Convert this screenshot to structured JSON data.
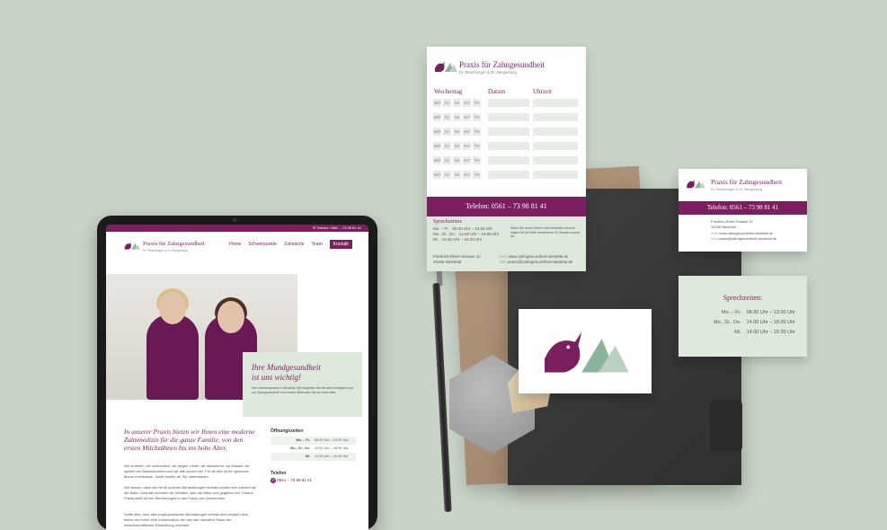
{
  "colors": {
    "brand": "#7b1f5f",
    "accent": "#8bb39a",
    "paper": "#ffffff",
    "mint": "#dfe8dd"
  },
  "brand": {
    "name": "Praxis für Zahngesundheit",
    "subtitle": "Dr. Brachvogel & Dr. Bergerlang",
    "logo_icon": "bird-mountains-logo-icon"
  },
  "appointment_card": {
    "headers": [
      "Wochentag",
      "Datum",
      "Uhrzeit"
    ],
    "days": [
      "MO",
      "DI",
      "MI",
      "DO",
      "FR"
    ],
    "row_count": 6,
    "phone": "Telefon: 0561 – 73 98 81 41",
    "hours_title": "Sprechzeiten:",
    "hours": [
      {
        "days": "Mo. – Fr.",
        "time": "08.00 Uhr – 13.00 Uhr"
      },
      {
        "days": "Mo., Di., Do.",
        "time": "14.00 Uhr – 18.00 Uhr"
      },
      {
        "days": "Mi.",
        "time": "14.00 Uhr – 19.30 Uhr"
      }
    ],
    "note": "Wenn Sie einen Termin nicht einhalten können, sagen Sie ihn bitte mindestens 24 Stunden vorher ab.",
    "address_line1": "Friedrich-Ebert-Strasse 12",
    "address_line2": "34266 Niestetal",
    "web_label": "Web",
    "web": "www.zahngesundheit-niestetal.de",
    "mail_label": "Mail",
    "mail": "praxis@zahngesundheit-niestetal.de"
  },
  "business_card": {
    "phone": "Telefon: 0561 – 73 98 81 41",
    "address_line1": "Friedrich-Ebert-Strasse 12",
    "address_line2": "34266 Niestetal",
    "web_label": "Web",
    "web": "www.zahngesundheit-niestetal.de",
    "mail_label": "Mail",
    "mail": "praxis@zahngesundheit-niestetal.de",
    "hours_title": "Sprechzeiten:",
    "hours": [
      {
        "days": "Mo. – Fr.",
        "time": "08.00 Uhr – 13.00 Uhr"
      },
      {
        "days": "Mo., Di., Do.",
        "time": "14.00 Uhr – 18.00 Uhr"
      },
      {
        "days": "Mi.",
        "time": "14.00 Uhr – 19.30 Uhr"
      }
    ]
  },
  "website": {
    "topbar_phone": "Telefon: 0561 – 73 98 81 41",
    "nav": [
      "Home",
      "Schwerpunkte",
      "Zahnärzte",
      "Team",
      "Kontakt"
    ],
    "hero_title_1": "Ihre Mundgesundheit",
    "hero_title_2": "ist uns wichtig!",
    "hero_text": "Ihre Zahnarztpraxis in Niestetal. Wir begleiten Sie bei allen Anliegen rund um Zahngesundheit vom ersten Milchzahn bis ins hohe Alter.",
    "intro_heading": "In unserer Praxis bieten wir Ihnen eine moderne Zahnmedizin für die ganze Familie, von den ersten Milchzähnen bis ins hohe Alter.",
    "para1": "Wir erzählen, wir schmecken, wir singen Lieder, wir diskutieren, wir küssen: wir spielen ein Blasinstrument und wir alle lachen viel. Für all dies ist ein gesunder Mund unerlässlich. Dabei wollen wir Sie unterstützen.",
    "para2": "Wir wissen, dass wir mit all unseren Behandlungen niemals besser sein werden als die Natur. Deshalb möchten wir erhalten, was die Natur uns gegeben hat. Unsere Praxis stellt all ihre Bemühungen in den Fokus des Zahnerhalts.",
    "para3": "Sollte dies, trotz aller prophylaktischer Bemühungen einmal nicht möglich sein, bieten wir Ihnen eine Zahnmedizin, die sich am neuesten Stand der wissenschaftlichen Entwicklung orientiert.",
    "hours_title": "Öffnungszeiten",
    "hours": [
      {
        "days": "Mo. – Fr.",
        "time": "08.00 Uhr – 13.00 Uhr"
      },
      {
        "days": "Mo., Di., Do.",
        "time": "14.00 Uhr – 18.00 Uhr"
      },
      {
        "days": "Mi.",
        "time": "14.00 Uhr – 19.30 Uhr"
      }
    ],
    "phone_title": "Telefon",
    "phone": "0561 – 73 98 81 41"
  }
}
